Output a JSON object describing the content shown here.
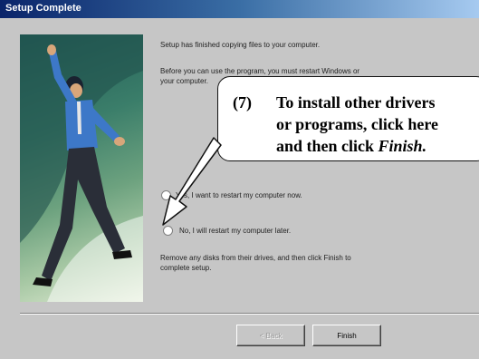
{
  "window": {
    "title": "Setup Complete"
  },
  "messages": {
    "line1": "Setup has finished copying files to your computer.",
    "line2a": "Before you can use the program, you must restart Windows or",
    "line2b": "your computer.",
    "line3a": "Remove any disks from their drives, and then click Finish to",
    "line3b": "complete setup."
  },
  "options": {
    "restart_now_label": "Yes, I want to restart my computer now.",
    "restart_later_label": "No, I will restart my computer later."
  },
  "buttons": {
    "back": "< Back",
    "finish": "Finish"
  },
  "callout": {
    "number": "(7)",
    "line1": "To install other drivers",
    "line2": "or programs, click here",
    "line3_prefix": "and then click ",
    "line3_emph": "Finish."
  }
}
